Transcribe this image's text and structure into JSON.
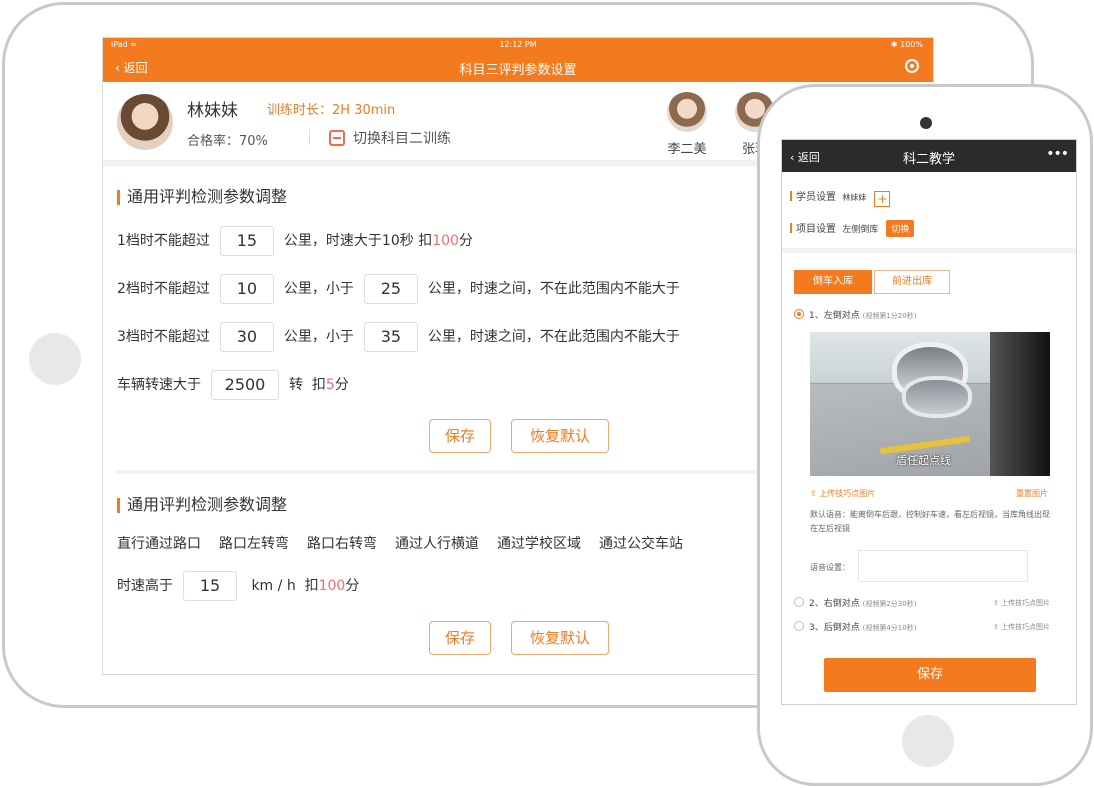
{
  "tablet": {
    "status": {
      "carrier": "iPad ≈",
      "time": "12:12 PM",
      "battery": "✱ 100%"
    },
    "nav": {
      "back": "返回",
      "title": "科目三评判参数设置"
    },
    "profile": {
      "name": "林妹妹",
      "train_time": "训练时长：2H 30min",
      "pass_rate": "合格率：70%",
      "switch_label": "切换科目二训练",
      "students": [
        {
          "name": "李二美"
        },
        {
          "name": "张玥"
        }
      ]
    },
    "section1": {
      "title": "通用评判检测参数调整",
      "row1": {
        "prefix": "1档时不能超过",
        "value": "15",
        "mid": "公里，时速大于10秒",
        "deduct_prefix": "扣",
        "deduct": "100",
        "deduct_unit": "分"
      },
      "row2": {
        "prefix": "2档时不能超过",
        "value1": "10",
        "mid": "公里，小于",
        "value2": "25",
        "suffix": "公里，时速之间，不在此范围内不能大于"
      },
      "row3": {
        "prefix": "3档时不能超过",
        "value1": "30",
        "mid": "公里，小于",
        "value2": "35",
        "suffix": "公里，时速之间，不在此范围内不能大于"
      },
      "row4": {
        "prefix": "车辆转速大于",
        "value": "2500",
        "unit": "转",
        "deduct_prefix": "扣",
        "deduct": "5",
        "deduct_unit": "分"
      },
      "save": "保存",
      "reset": "恢复默认"
    },
    "section2": {
      "title": "通用评判检测参数调整",
      "options": [
        "直行通过路口",
        "路口左转弯",
        "路口右转弯",
        "通过人行横道",
        "通过学校区域",
        "通过公交车站"
      ],
      "speed": {
        "prefix": "时速高于",
        "value": "15",
        "unit": "km / h",
        "deduct_prefix": "扣",
        "deduct": "100",
        "deduct_unit": "分"
      },
      "save": "保存",
      "reset": "恢复默认"
    }
  },
  "phone": {
    "nav": {
      "back": "返回",
      "title": "科二教学",
      "more": "•••"
    },
    "student_setting": {
      "label": "学员设置",
      "value": "林妹妹",
      "add": "+"
    },
    "project_setting": {
      "label": "项目设置",
      "value": "左侧倒库",
      "tag": "切换"
    },
    "tabs": [
      "倒车入库",
      "前进出库"
    ],
    "item1": {
      "label": "1、左倒对点",
      "note": "(视频第1分20秒)"
    },
    "photo_caption": "盾任起点线",
    "upload_left": "上传技巧点图片",
    "upload_right": "重置图片",
    "description": "默认语音：能离倒车后跟，控制好车速，看左后视镜，当库角线出现在左后视镜",
    "comment_label": "语音设置：",
    "item2": {
      "label": "2、右倒对点",
      "note": "(视频第2分30秒)",
      "upload": "上传技巧点图片"
    },
    "item3": {
      "label": "3、后倒对点",
      "note": "(视频第4分10秒)",
      "upload": "上传技巧点图片"
    },
    "save": "保存"
  },
  "colors": {
    "accent": "#f47a1f",
    "deduct_red": "#f56c6c",
    "phone_nav": "#2b2b2b"
  }
}
